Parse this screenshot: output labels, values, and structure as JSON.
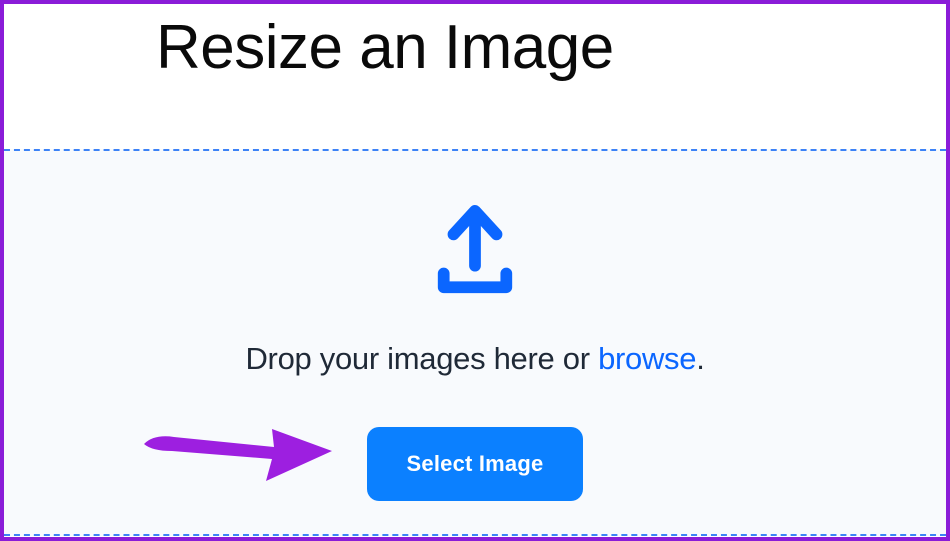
{
  "header": {
    "title": "Resize an Image"
  },
  "dropzone": {
    "instruction_prefix": "Drop your images here or ",
    "browse_label": "browse",
    "instruction_suffix": ".",
    "button_label": "Select Image"
  },
  "colors": {
    "frame_border": "#8a1cd8",
    "dashed_border": "#3c82f6",
    "accent_blue": "#0b80ff",
    "link_blue": "#0b66ff",
    "dropzone_bg": "#f8fafd",
    "annotation_purple": "#9d1fe0"
  }
}
